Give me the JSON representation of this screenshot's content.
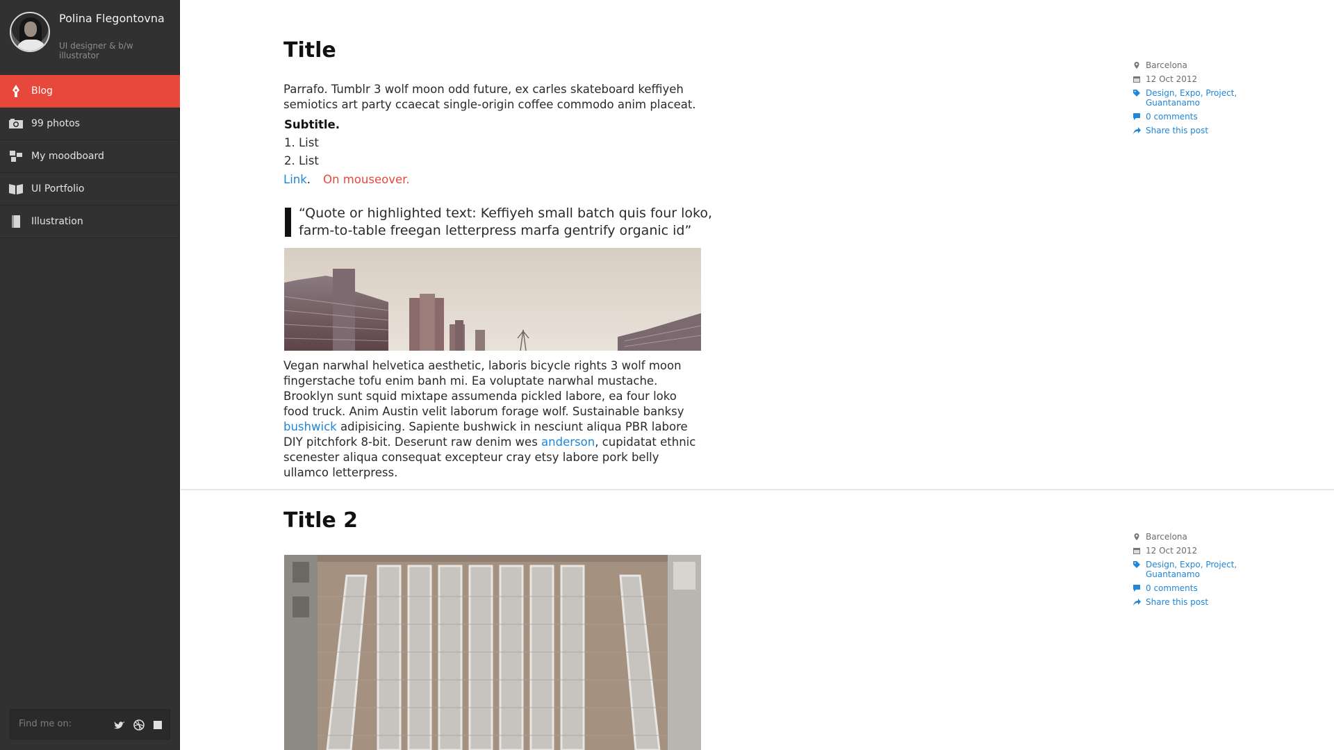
{
  "profile": {
    "name": "Polina Flegontovna",
    "role": "UI designer & b/w illustrator"
  },
  "nav": [
    {
      "label": "Blog",
      "icon": "pen-nib-icon",
      "active": true
    },
    {
      "label": "99 photos",
      "icon": "camera-icon",
      "active": false
    },
    {
      "label": "My moodboard",
      "icon": "moodboard-icon",
      "active": false
    },
    {
      "label": "UI Portfolio",
      "icon": "open-book-icon",
      "active": false
    },
    {
      "label": "Illustration",
      "icon": "book-icon",
      "active": false
    }
  ],
  "social": {
    "label": "Find me on:",
    "icons": [
      "twitter-icon",
      "dribbble-icon",
      "square-icon"
    ]
  },
  "colors": {
    "accent": "#e8483b",
    "link": "#1f86d8",
    "sidebar": "#313131"
  },
  "posts": [
    {
      "title": "Title",
      "intro": "Parrafo. Tumblr 3 wolf moon odd future, ex carles skateboard keffiyeh semiotics art party ccaecat single-origin coffee commodo anim placeat.",
      "subtitle": "Subtitle.",
      "list": [
        "1. List",
        "2. List"
      ],
      "link_label": "Link",
      "link_suffix": ".",
      "hover_label": "On mouseover.",
      "quote": "“Quote or highlighted text: Keffiyeh small batch quis four loko, farm-to-table freegan letterpress marfa gentrify organic id”",
      "body_part1": "Vegan narwhal helvetica aesthetic, laboris bicycle rights 3 wolf moon fingerstache tofu enim banh mi. Ea voluptate narwhal mustache. Brooklyn sunt squid mixtape assumenda pickled labore, ea four loko food truck. Anim Austin velit laborum forage wolf. Sustainable banksy ",
      "body_link1": "bushwick",
      "body_part2": " adipisicing. Sapiente bushwick in nesciunt aliqua PBR labore DIY pitchfork 8-bit. Deserunt raw denim wes ",
      "body_link2": "anderson",
      "body_part3": ", cupidatat ethnic scenester aliqua consequat excepteur cray etsy labore pork belly ullamco letterpress.",
      "meta": {
        "location": "Barcelona",
        "date": "12 Oct 2012",
        "tags": "Design, Expo, Project, Guantanamo",
        "comments": "0 comments",
        "share": "Share this post"
      }
    },
    {
      "title": "Title 2",
      "meta": {
        "location": "Barcelona",
        "date": "12 Oct 2012",
        "tags": "Design, Expo, Project, Guantanamo",
        "comments": "0 comments",
        "share": "Share this post"
      }
    }
  ]
}
